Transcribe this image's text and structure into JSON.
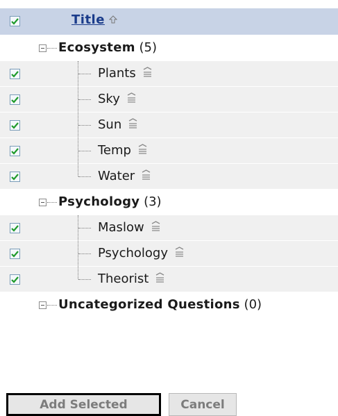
{
  "header": {
    "title": "Title",
    "checked": true
  },
  "categories": [
    {
      "name": "Ecosystem",
      "count": "(5)",
      "items": [
        {
          "label": "Plants",
          "checked": true
        },
        {
          "label": "Sky",
          "checked": true
        },
        {
          "label": "Sun",
          "checked": true
        },
        {
          "label": "Temp",
          "checked": true
        },
        {
          "label": "Water",
          "checked": true
        }
      ]
    },
    {
      "name": "Psychology",
      "count": "(3)",
      "items": [
        {
          "label": "Maslow",
          "checked": true
        },
        {
          "label": "Psychology",
          "checked": true
        },
        {
          "label": "Theorist",
          "checked": true
        }
      ]
    },
    {
      "name": "Uncategorized Questions",
      "count": "(0)",
      "items": []
    }
  ],
  "buttons": {
    "add_selected": "Add Selected",
    "cancel": "Cancel"
  },
  "colors": {
    "header_bg": "#c8d3e6",
    "row_bg": "#f0f0f0",
    "check": "#1e9a2a",
    "title_link": "#1a3b8a"
  },
  "icons": {
    "sort": "sort-up-icon",
    "row_menu": "row-menu-icon",
    "collapse": "collapse-icon"
  }
}
